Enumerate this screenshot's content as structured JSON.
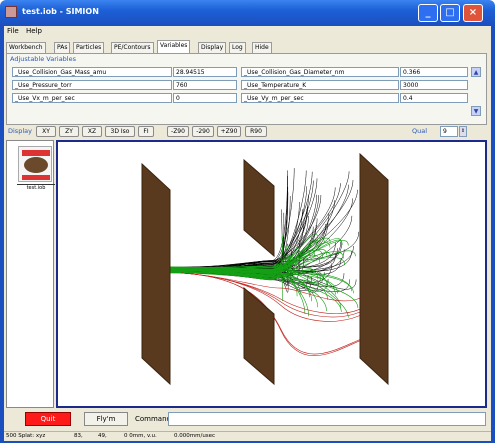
{
  "window": {
    "title": "test.iob - SIMION"
  },
  "menu": [
    "File",
    "Help"
  ],
  "tabs": [
    {
      "label": "Workbench"
    },
    {
      "label": "PAs"
    },
    {
      "label": "Particles"
    },
    {
      "label": "PE/Contours"
    },
    {
      "label": "Variables",
      "active": true
    },
    {
      "label": "Display"
    },
    {
      "label": "Log"
    },
    {
      "label": "Hide"
    }
  ],
  "variables": {
    "header": "Adjustable Variables",
    "rows": [
      {
        "name1": "_Use_Collision_Gas_Mass_amu",
        "value1": "28.94515",
        "name2": "_Use_Collision_Gas_Diameter_nm",
        "value2": "0.366"
      },
      {
        "name1": "_Use_Pressure_torr",
        "value1": "760",
        "name2": "_Use_Temperature_K",
        "value2": "3000"
      },
      {
        "name1": "_Use_Vx_m_per_sec",
        "value1": "0",
        "name2": "_Use_Vy_m_per_sec",
        "value2": "0.4"
      }
    ]
  },
  "toolbar": {
    "display_label": "Display",
    "buttons": [
      "XY",
      "ZY",
      "XZ",
      "3D Iso",
      "FI",
      "-Z90",
      "-290",
      "+Z90",
      "R90",
      "Qual"
    ],
    "qual_value": "9"
  },
  "thumbnail": {
    "label": "test.iob"
  },
  "bottom": {
    "quit": "Quit",
    "run": "Fly'm",
    "command_label": "Command:"
  },
  "status": [
    "500 Splat: xyz",
    "83,",
    "49,",
    "0 0mm, v.u.",
    "0.000mm/usec"
  ],
  "icons": {
    "app": "simion-app-icon",
    "minimize": "minimize-icon",
    "maximize": "maximize-icon",
    "close": "close-icon"
  },
  "colors": {
    "titlebar": "#1d5fd6",
    "electrode": "#5a3a1e",
    "trajectories_black": "#000000",
    "trajectories_green": "#15a015",
    "trajectories_red": "#c0201a",
    "quit": "#ff1a1a",
    "view_border": "#1c2a8c"
  }
}
